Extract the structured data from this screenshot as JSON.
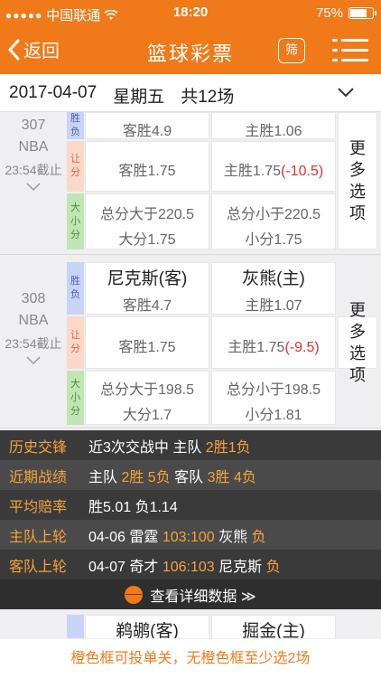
{
  "status_bar": {
    "signal": "●●●●●",
    "carrier": "中国联通",
    "time": "18:20",
    "battery_text": "75%",
    "battery_level": 0.75
  },
  "nav": {
    "back_label": "返回",
    "title": "篮球彩票",
    "filter_label": "筛"
  },
  "date_bar": {
    "date": "2017-04-07",
    "weekday": "星期五",
    "count": "共12场"
  },
  "tags": {
    "sf": "胜负",
    "rf": "让分",
    "dx": "大小分"
  },
  "more_label": "更多选项",
  "match_top": {
    "num": "307",
    "league": "NBA",
    "deadline": "23:54截止",
    "sf": {
      "away_odd": "客胜4.9",
      "home_odd": "主胜1.06"
    },
    "rf": {
      "away_odd": "客胜1.75",
      "home_odd": "主胜1.75",
      "handicap": "(-10.5)"
    },
    "dx": {
      "over": "总分大于220.5",
      "over_odd": "大分1.75",
      "under": "总分小于220.5",
      "under_odd": "小分1.75"
    }
  },
  "match_308": {
    "num": "308",
    "league": "NBA",
    "deadline": "23:54截止",
    "sf": {
      "away_team": "尼克斯(客)",
      "away_odd": "客胜4.7",
      "home_team": "灰熊(主)",
      "home_odd": "主胜1.07"
    },
    "rf": {
      "away_odd": "客胜1.75",
      "home_odd": "主胜1.75",
      "handicap": "(-9.5)"
    },
    "dx": {
      "over": "总分大于198.5",
      "over_odd": "大分1.7",
      "under": "总分小于198.5",
      "under_odd": "小分1.81"
    }
  },
  "stats": {
    "history": {
      "label": "历史交锋",
      "t1": "近3次交战中 主队 ",
      "v1": "2胜1负"
    },
    "recent": {
      "label": "近期战绩",
      "t1": "主队 ",
      "v1": "2胜 5负",
      "t2": " 客队 ",
      "v2": "3胜 4负"
    },
    "avg_odds": {
      "label": "平均赔率",
      "t1": "胜5.01 负1.14"
    },
    "home_last": {
      "label": "主队上轮",
      "t1": "04-06 雷霆 ",
      "v1": "103:100",
      "t2": " 灰熊 ",
      "v2": "负"
    },
    "away_last": {
      "label": "客队上轮",
      "t1": "04-07 奇才 ",
      "v1": "106:103",
      "t2": " 尼克斯 ",
      "v2": "负"
    },
    "detail_link": "查看详细数据 ≫"
  },
  "peek": {
    "away_team": "鹈鹕(客)",
    "home_team": "掘金(主)"
  },
  "footer": "橙色框可投单关，无橙色框至少选2场"
}
